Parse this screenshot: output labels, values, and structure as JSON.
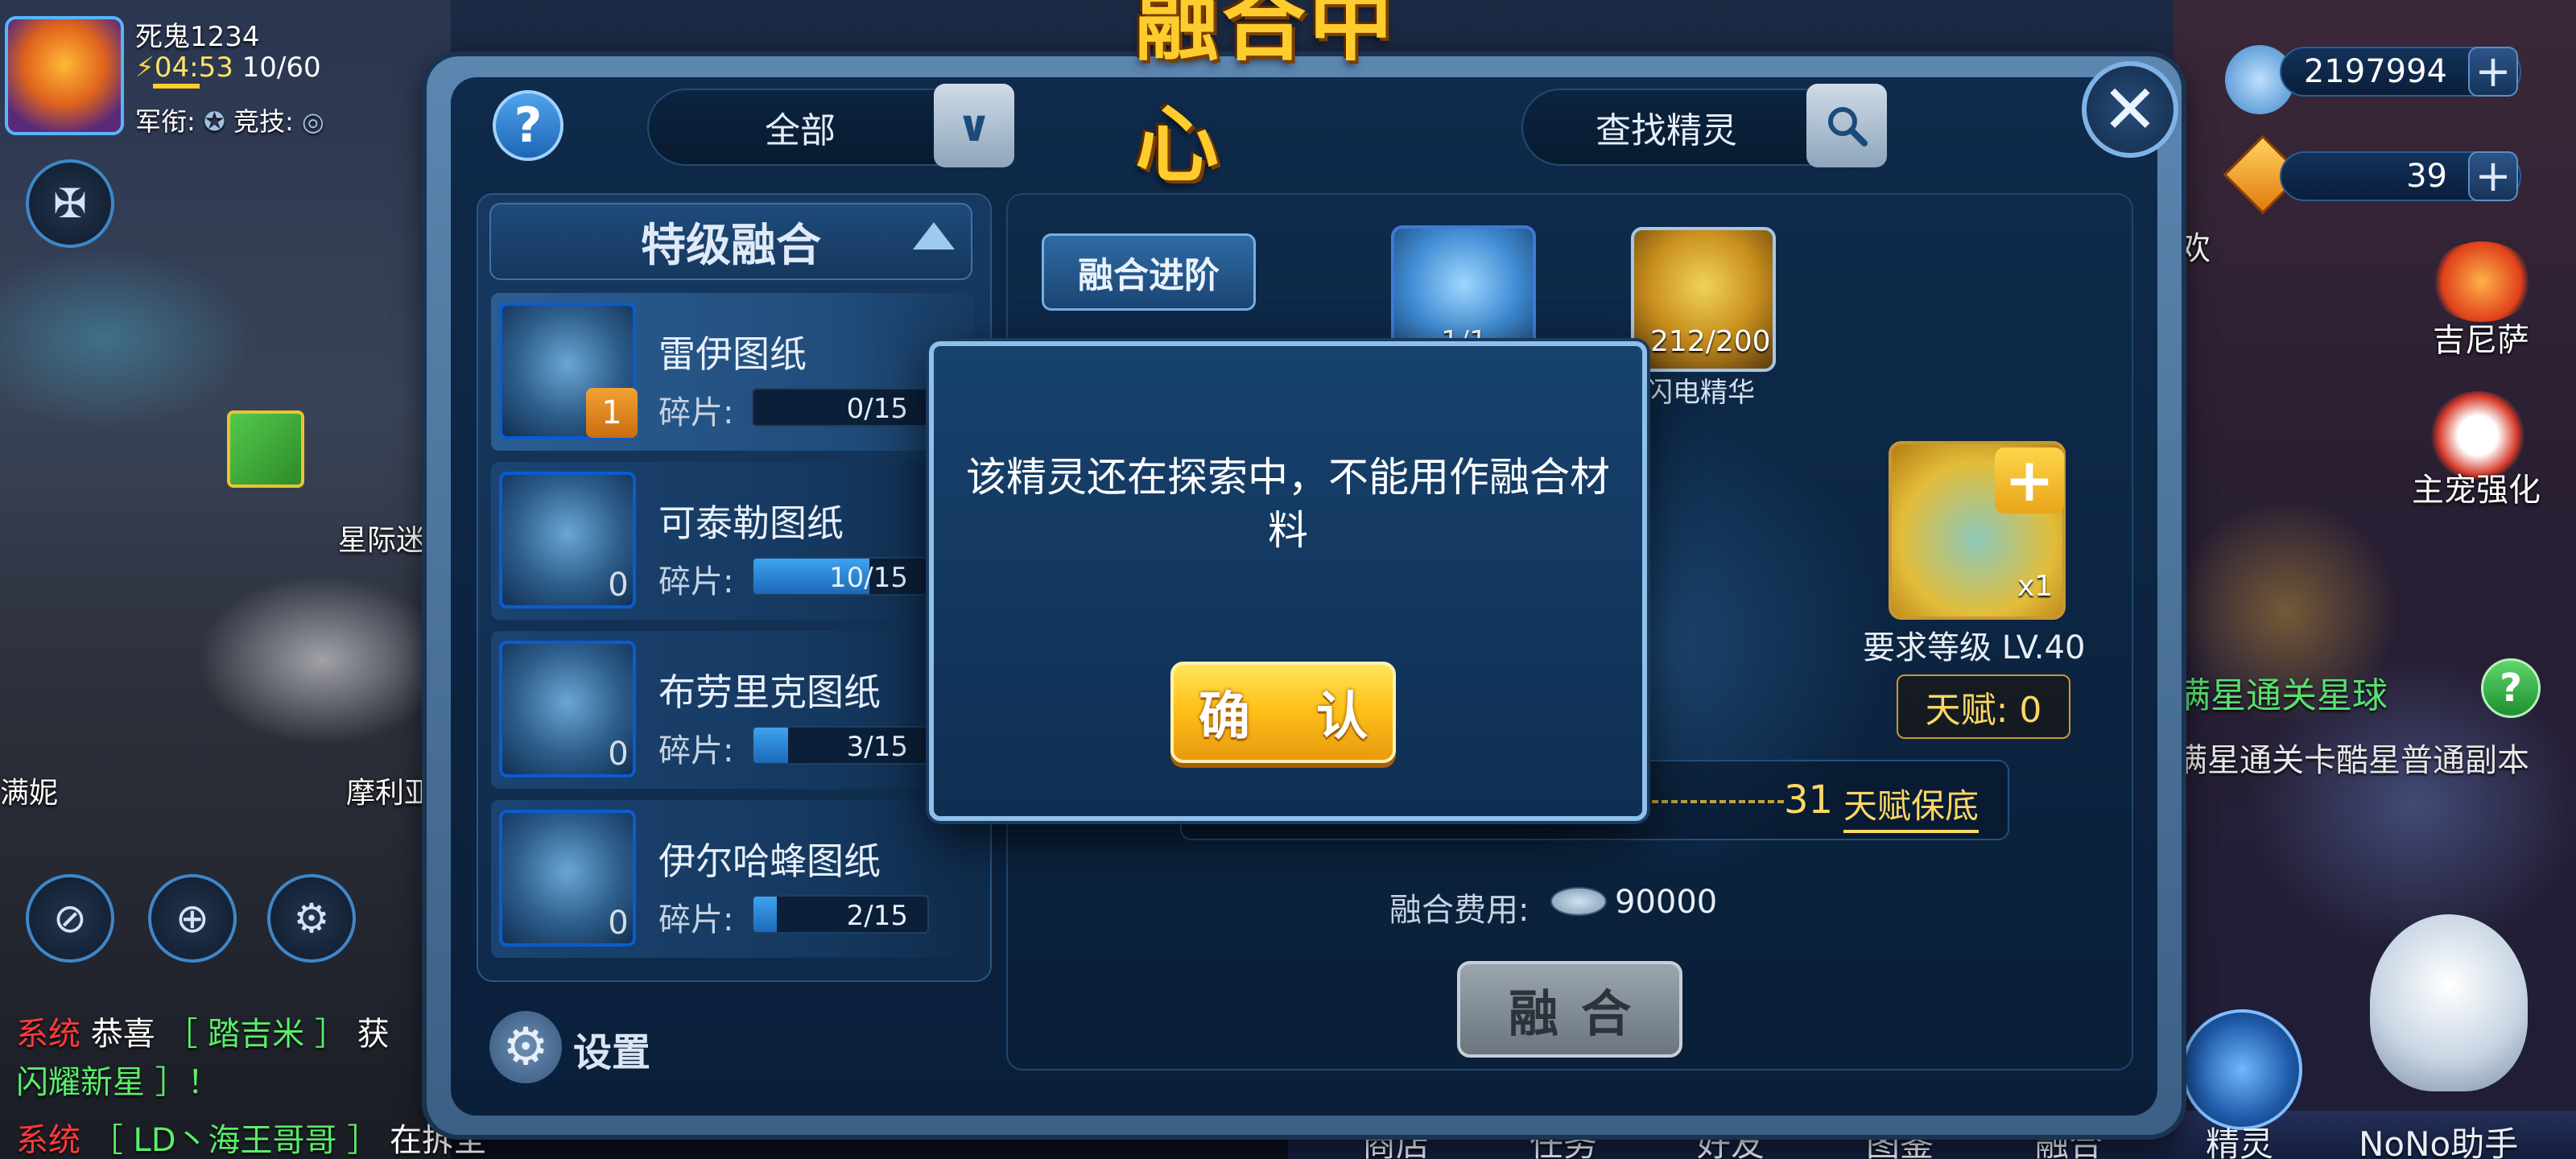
{
  "player": {
    "name": "死鬼1234",
    "energy_time": "04:53",
    "energy_value": "10/60",
    "rank_label": "军衔:",
    "arena_label": "竞技:"
  },
  "currency": [
    {
      "icon": "saucer-coin-icon",
      "value": "2197994"
    },
    {
      "icon": "diamond-icon",
      "value": "39"
    }
  ],
  "side_menu": [
    {
      "label": "吉尼萨",
      "icon": "flame-creature-icon"
    },
    {
      "label": "主宠强化",
      "icon": "pet-icon"
    }
  ],
  "side_partial_text": "欢",
  "quest": {
    "title": "满星通关星球",
    "description": "满星通关卡酷星普通副本"
  },
  "chat": [
    {
      "tag": "系统",
      "text": "恭喜",
      "name": "［ 踏吉米 ］",
      "suffix": "获"
    },
    {
      "line2": "闪耀新星 ］！"
    },
    {
      "tag": "系统",
      "name": "［ LD丶海王哥哥 ］",
      "suffix": "在拆圣"
    }
  ],
  "left_scene_labels": [
    "星际迷",
    "摩利亚",
    "满妮"
  ],
  "bottom_nav": [
    "商店",
    "任务",
    "好友",
    "图鉴",
    "融合",
    "精灵",
    "NoNo助手"
  ],
  "panel": {
    "title": "融合中心",
    "filter_value": "全部",
    "search_placeholder": "查找精灵",
    "category": "特级融合",
    "settings_label": "设置",
    "advance_button": "融合进阶",
    "fuse_button": "融合",
    "cost_label": "融合费用:",
    "cost_value": "90000",
    "req_level": "要求等级 LV.40",
    "talent": "天赋: 0",
    "talent_guarantee_num": "31",
    "talent_guarantee_label": "天赋保底",
    "target_count": "x1"
  },
  "materials": [
    {
      "label": "",
      "count": "1/1"
    },
    {
      "label": "闪电精华",
      "count": "212/200"
    }
  ],
  "recipes": [
    {
      "name": "雷伊图纸",
      "frag_label": "碎片:",
      "progress": "0/15",
      "fill": 0.0,
      "count": "1",
      "highlight": true
    },
    {
      "name": "可泰勒图纸",
      "frag_label": "碎片:",
      "progress": "10/15",
      "fill": 0.667,
      "count": "0",
      "highlight": false
    },
    {
      "name": "布劳里克图纸",
      "frag_label": "碎片:",
      "progress": "3/15",
      "fill": 0.2,
      "count": "0",
      "highlight": false
    },
    {
      "name": "伊尔哈蜂图纸",
      "frag_label": "碎片:",
      "progress": "2/15",
      "fill": 0.133,
      "count": "0",
      "highlight": false
    }
  ],
  "dialog": {
    "message": "该精灵还在探索中，不能用作融合材料",
    "confirm": "确 认"
  },
  "colors": {
    "accent_gold": "#ffcc2e",
    "panel_blue": "#0f2a4a",
    "quest_green": "#57e06f",
    "chat_red": "#ff3b3b"
  }
}
